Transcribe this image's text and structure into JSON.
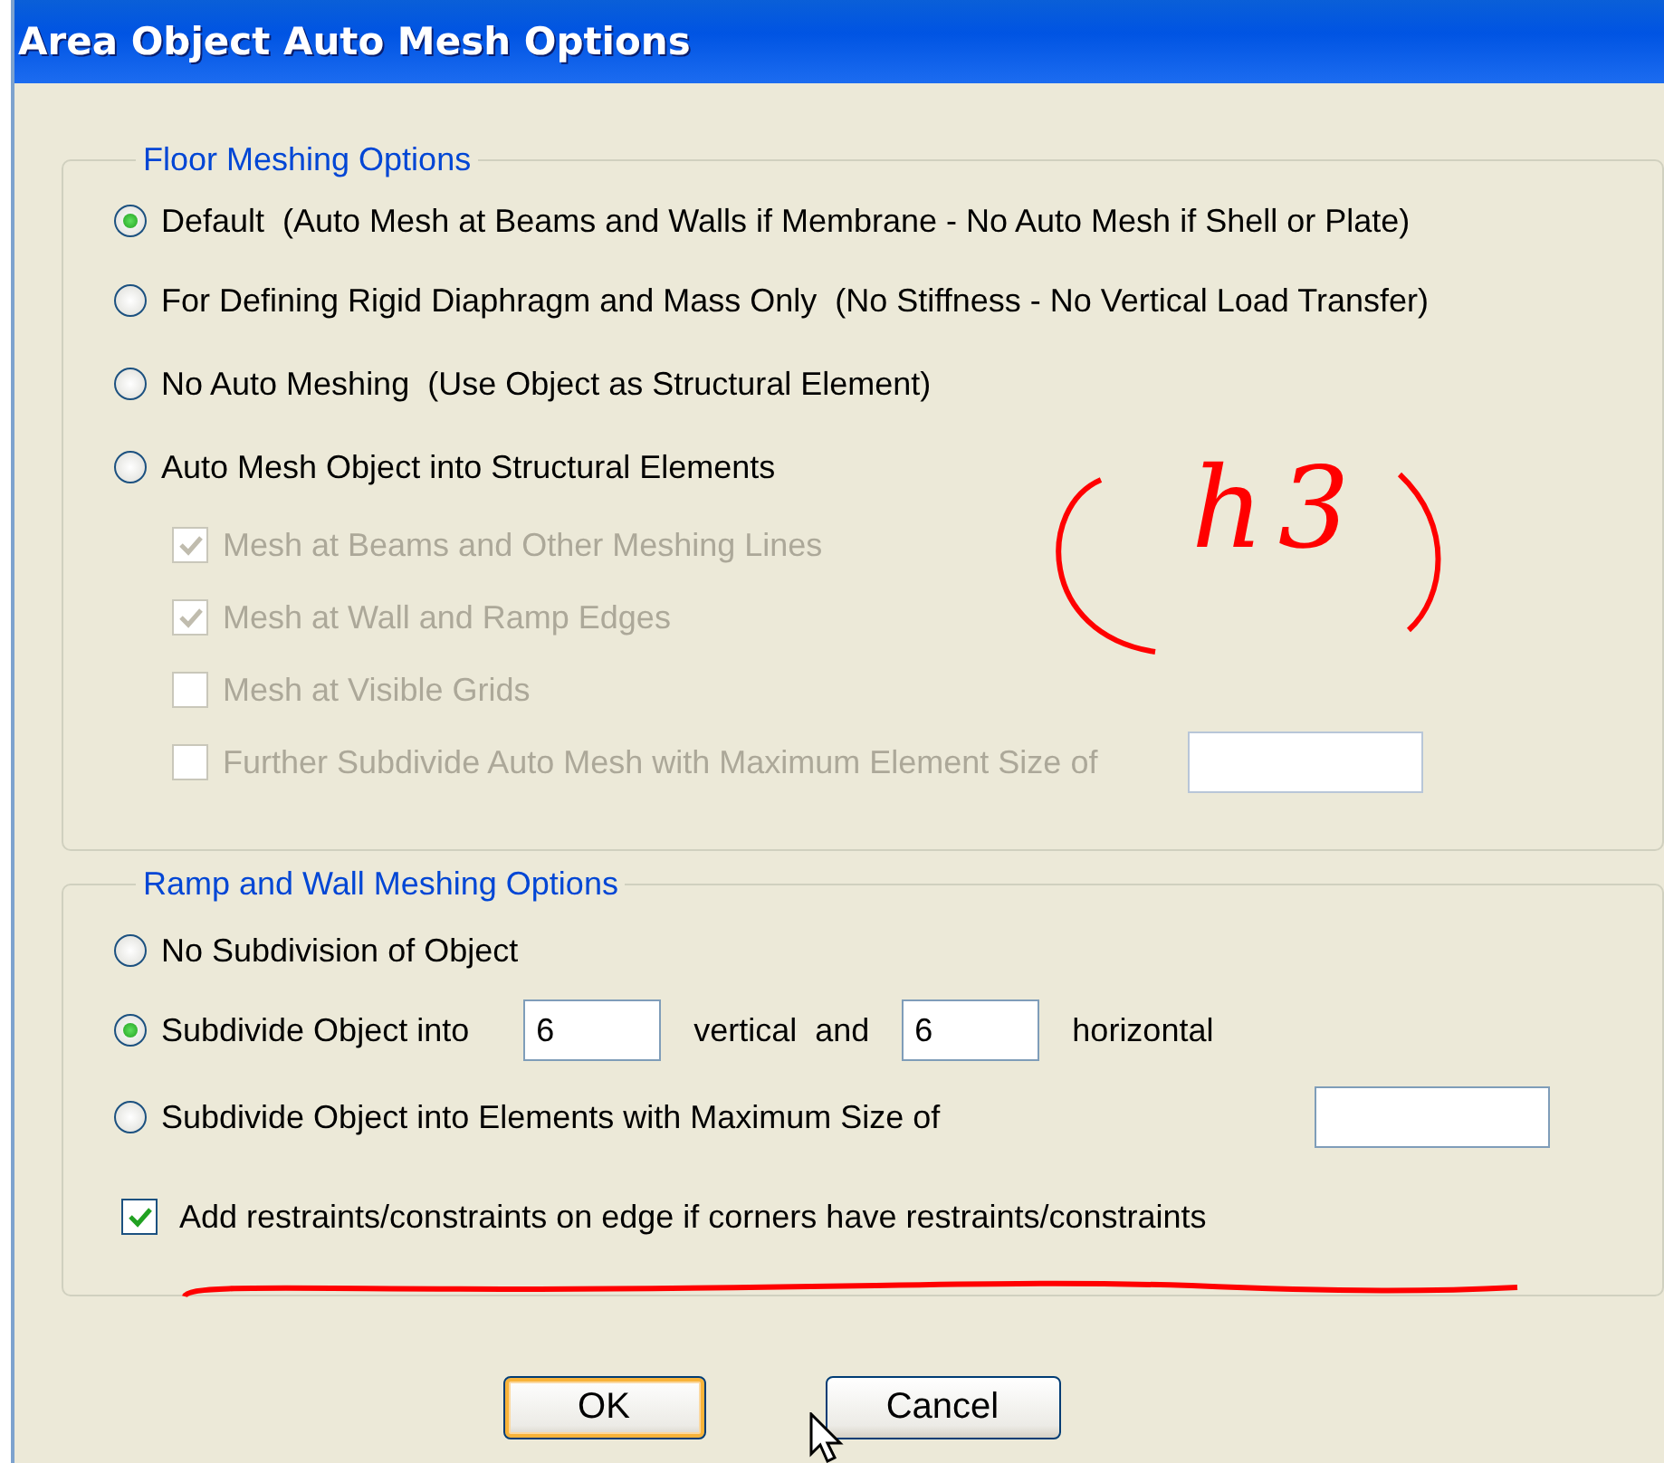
{
  "window": {
    "title": "Area Object Auto Mesh Options"
  },
  "floor_meshing": {
    "title": "Floor Meshing Options",
    "options": [
      {
        "label": "Default  (Auto Mesh at Beams and Walls if Membrane - No Auto Mesh if Shell or Plate)",
        "selected": true
      },
      {
        "label": "For Defining Rigid Diaphragm and Mass Only  (No Stiffness - No Vertical Load Transfer)",
        "selected": false
      },
      {
        "label": "No Auto Meshing  (Use Object as Structural Element)",
        "selected": false
      },
      {
        "label": "Auto Mesh Object into Structural Elements",
        "selected": false
      }
    ],
    "sub_options": [
      {
        "kind": "plain",
        "label": "Mesh at Beams and Other Meshing Lines",
        "checked": true,
        "disabled": true
      },
      {
        "kind": "plain",
        "label": "Mesh at Wall and Ramp Edges",
        "checked": true,
        "disabled": true
      },
      {
        "kind": "plain",
        "label": "Mesh at Visible Grids",
        "checked": false,
        "disabled": true
      },
      {
        "kind": "with_field",
        "label": "Further Subdivide Auto Mesh with Maximum Element Size of",
        "checked": false,
        "disabled": true
      }
    ]
  },
  "ramp_wall_meshing": {
    "title": "Ramp and Wall Meshing Options",
    "options": [
      {
        "selected": false,
        "parts": [
          {
            "kind": "text",
            "text": "No Subdivision of Object"
          }
        ]
      },
      {
        "selected": true,
        "parts": [
          {
            "kind": "text",
            "text": "Subdivide Object into"
          },
          {
            "kind": "field",
            "value": "6"
          },
          {
            "kind": "text",
            "text": "vertical  and"
          },
          {
            "kind": "field",
            "value": "6"
          },
          {
            "kind": "text",
            "text": "horizontal"
          }
        ]
      },
      {
        "selected": false,
        "parts": [
          {
            "kind": "text",
            "text": "Subdivide Object into Elements with Maximum Size of"
          },
          {
            "kind": "end_field"
          }
        ]
      }
    ],
    "edge_constraints": {
      "label": "Add restraints/constraints on edge if corners have restraints/constraints",
      "checked": true
    }
  },
  "buttons": [
    {
      "label": "OK",
      "focused": true
    },
    {
      "label": "Cancel",
      "focused": false
    }
  ],
  "annotation": {
    "text": "h3"
  }
}
